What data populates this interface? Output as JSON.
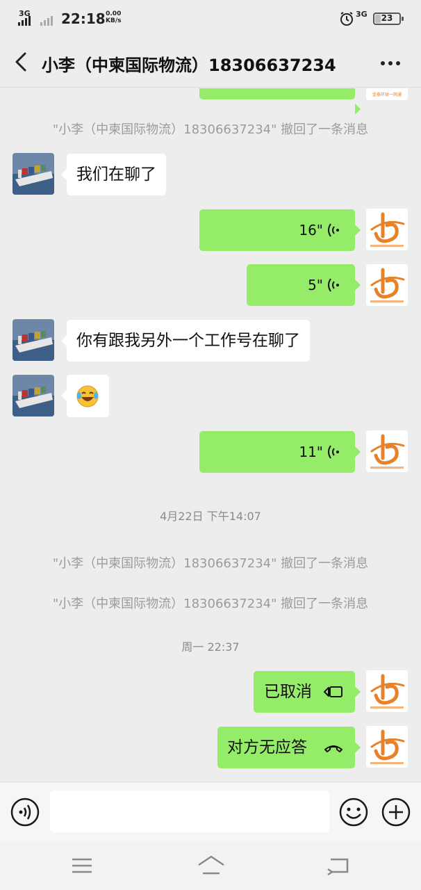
{
  "status_bar": {
    "network": "3G",
    "time": "22:18",
    "speed_value": "0.00",
    "speed_unit": "KB/s",
    "network2": "3G",
    "battery": "23",
    "battery_level": 0.23
  },
  "header": {
    "title": "小李（中柬国际物流）18306637234"
  },
  "messages": {
    "recall_1": "\"小李（中柬国际物流）18306637234\" 撤回了一条消息",
    "in_1": "我们在聊了",
    "voice_1": "16\"",
    "voice_2": "5\"",
    "in_2": "你有跟我另外一个工作号在聊了",
    "voice_3": "11\"",
    "time_1": "4月22日 下午14:07",
    "recall_2": "\"小李（中柬国际物流）18306637234\" 撤回了一条消息",
    "recall_3": "\"小李（中柬国际物流）18306637234\" 撤回了一条消息",
    "time_2": "周一 22:37",
    "call_cancelled": "已取消",
    "call_no_answer": "对方无应答"
  },
  "input": {
    "placeholder": ""
  },
  "colors": {
    "bubble_out": "#95ec69",
    "bubble_in": "#ffffff",
    "background": "#ededed",
    "logo_orange": "#e8822a"
  }
}
